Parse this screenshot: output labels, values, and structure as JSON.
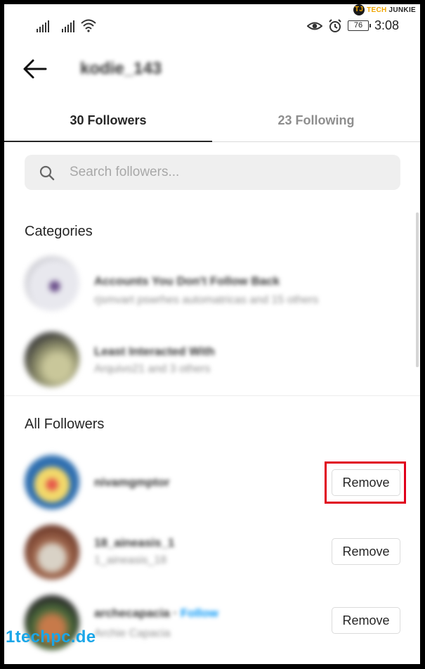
{
  "status_bar": {
    "battery": "76",
    "time": "3:08"
  },
  "brand": {
    "logo_letter": "TJ",
    "part1": "TECH",
    "part2": "JUNKIE"
  },
  "header": {
    "username": "kodie_143"
  },
  "tabs": [
    {
      "label": "30 Followers",
      "active": true
    },
    {
      "label": "23 Following",
      "active": false
    }
  ],
  "search": {
    "placeholder": "Search followers..."
  },
  "categories": {
    "title": "Categories",
    "items": [
      {
        "title": "Accounts You Don't Follow Back",
        "subtitle": "rjsmvart pswrhes automatricas and 15 others"
      },
      {
        "title": "Least Interacted With",
        "subtitle": "Arquivo21 and 3 others"
      }
    ]
  },
  "all_followers": {
    "title": "All Followers",
    "items": [
      {
        "username": "nivamgmptor",
        "name": "",
        "follow": "",
        "button": "Remove"
      },
      {
        "username": "18_aineasis_1",
        "name": "1_aineasis_18",
        "follow": "",
        "button": "Remove"
      },
      {
        "username": "archecapacia",
        "name": "Archie Capacia",
        "follow": "Follow",
        "button": "Remove"
      }
    ]
  },
  "watermark": "1techpc.de",
  "colors": {
    "highlight": "#e0001b",
    "link": "#0095f6",
    "watermark": "#1aa6e8",
    "brand": "#f0a500"
  }
}
